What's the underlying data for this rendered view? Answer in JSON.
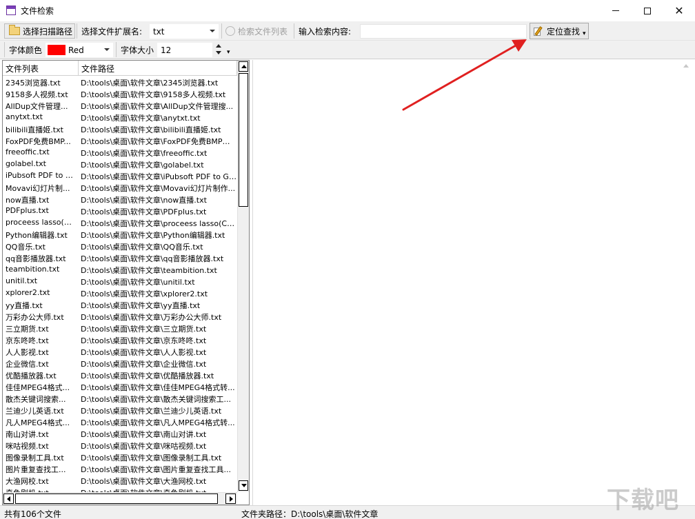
{
  "window": {
    "title": "文件检索",
    "controls": [
      "minimize",
      "maximize",
      "close"
    ]
  },
  "toolbar1": {
    "choose_path_label": "选择扫描路径",
    "ext_label": "选择文件扩展名:",
    "ext_value": "txt",
    "search_list_label": "检索文件列表",
    "content_label": "输入检索内容:",
    "content_value": "",
    "locate_label": "定位查找"
  },
  "toolbar2": {
    "font_color_label": "字体颜色",
    "font_color_value": "Red",
    "font_color_hex": "#ff0000",
    "font_size_label": "字体大小",
    "font_size_value": "12"
  },
  "file_list": {
    "headers": [
      "文件列表",
      "文件路径"
    ],
    "rows": [
      {
        "name": "2345浏览器.txt",
        "path": "D:\\tools\\桌面\\软件文章\\2345浏览器.txt"
      },
      {
        "name": "9158多人视频.txt",
        "path": "D:\\tools\\桌面\\软件文章\\9158多人视频.txt"
      },
      {
        "name": "AllDup文件管理...",
        "path": "D:\\tools\\桌面\\软件文章\\AllDup文件管理搜..."
      },
      {
        "name": "anytxt.txt",
        "path": "D:\\tools\\桌面\\软件文章\\anytxt.txt"
      },
      {
        "name": "bilibili直播姬.txt",
        "path": "D:\\tools\\桌面\\软件文章\\bilibili直播姬.txt"
      },
      {
        "name": "FoxPDF免费BMP...",
        "path": "D:\\tools\\桌面\\软件文章\\FoxPDF免费BMP转..."
      },
      {
        "name": "freeoffic.txt",
        "path": "D:\\tools\\桌面\\软件文章\\freeoffic.txt"
      },
      {
        "name": "golabel.txt",
        "path": "D:\\tools\\桌面\\软件文章\\golabel.txt"
      },
      {
        "name": "iPubsoft PDF to G...",
        "path": "D:\\tools\\桌面\\软件文章\\iPubsoft PDF to GIF ..."
      },
      {
        "name": "Movavi幻灯片制...",
        "path": "D:\\tools\\桌面\\软件文章\\Movavi幻灯片制作..."
      },
      {
        "name": "now直播.txt",
        "path": "D:\\tools\\桌面\\软件文章\\now直播.txt"
      },
      {
        "name": "PDFplus.txt",
        "path": "D:\\tools\\桌面\\软件文章\\PDFplus.txt"
      },
      {
        "name": "proceess lasso(CP...",
        "path": "D:\\tools\\桌面\\软件文章\\proceess lasso(CPU..."
      },
      {
        "name": "Python编辑器.txt",
        "path": "D:\\tools\\桌面\\软件文章\\Python编辑器.txt"
      },
      {
        "name": "QQ音乐.txt",
        "path": "D:\\tools\\桌面\\软件文章\\QQ音乐.txt"
      },
      {
        "name": "qq音影播放器.txt",
        "path": "D:\\tools\\桌面\\软件文章\\qq音影播放器.txt"
      },
      {
        "name": "teambition.txt",
        "path": "D:\\tools\\桌面\\软件文章\\teambition.txt"
      },
      {
        "name": "unitil.txt",
        "path": "D:\\tools\\桌面\\软件文章\\unitil.txt"
      },
      {
        "name": "xplorer2.txt",
        "path": "D:\\tools\\桌面\\软件文章\\xplorer2.txt"
      },
      {
        "name": "yy直播.txt",
        "path": "D:\\tools\\桌面\\软件文章\\yy直播.txt"
      },
      {
        "name": "万彩办公大师.txt",
        "path": "D:\\tools\\桌面\\软件文章\\万彩办公大师.txt"
      },
      {
        "name": "三立期货.txt",
        "path": "D:\\tools\\桌面\\软件文章\\三立期货.txt"
      },
      {
        "name": "京东咚咚.txt",
        "path": "D:\\tools\\桌面\\软件文章\\京东咚咚.txt"
      },
      {
        "name": "人人影视.txt",
        "path": "D:\\tools\\桌面\\软件文章\\人人影视.txt"
      },
      {
        "name": "企业微信.txt",
        "path": "D:\\tools\\桌面\\软件文章\\企业微信.txt"
      },
      {
        "name": "优酷播放器.txt",
        "path": "D:\\tools\\桌面\\软件文章\\优酷播放器.txt"
      },
      {
        "name": "佳佳MPEG4格式...",
        "path": "D:\\tools\\桌面\\软件文章\\佳佳MPEG4格式转..."
      },
      {
        "name": "散杰关键词搜索...",
        "path": "D:\\tools\\桌面\\软件文章\\散杰关键词搜索工..."
      },
      {
        "name": "兰迪少儿英语.txt",
        "path": "D:\\tools\\桌面\\软件文章\\兰迪少儿英语.txt"
      },
      {
        "name": "凡人MPEG4格式...",
        "path": "D:\\tools\\桌面\\软件文章\\凡人MPEG4格式转..."
      },
      {
        "name": "南山对讲.txt",
        "path": "D:\\tools\\桌面\\软件文章\\南山对讲.txt"
      },
      {
        "name": "咪咕视频.txt",
        "path": "D:\\tools\\桌面\\软件文章\\咪咕视频.txt"
      },
      {
        "name": "图像录制工具.txt",
        "path": "D:\\tools\\桌面\\软件文章\\图像录制工具.txt"
      },
      {
        "name": "图片重复查找工...",
        "path": "D:\\tools\\桌面\\软件文章\\图片重复查找工具..."
      },
      {
        "name": "大渔网校.txt",
        "path": "D:\\tools\\桌面\\软件文章\\大渔网校.txt"
      },
      {
        "name": "奇鱼剧机.txt",
        "path": "D:\\tools\\桌面\\软件文章\\奇鱼剧机.txt"
      }
    ]
  },
  "status": {
    "count_text": "共有106个文件",
    "folder_path_text": "文件夹路径：D:\\tools\\桌面\\软件文章"
  },
  "watermark": "下载吧"
}
